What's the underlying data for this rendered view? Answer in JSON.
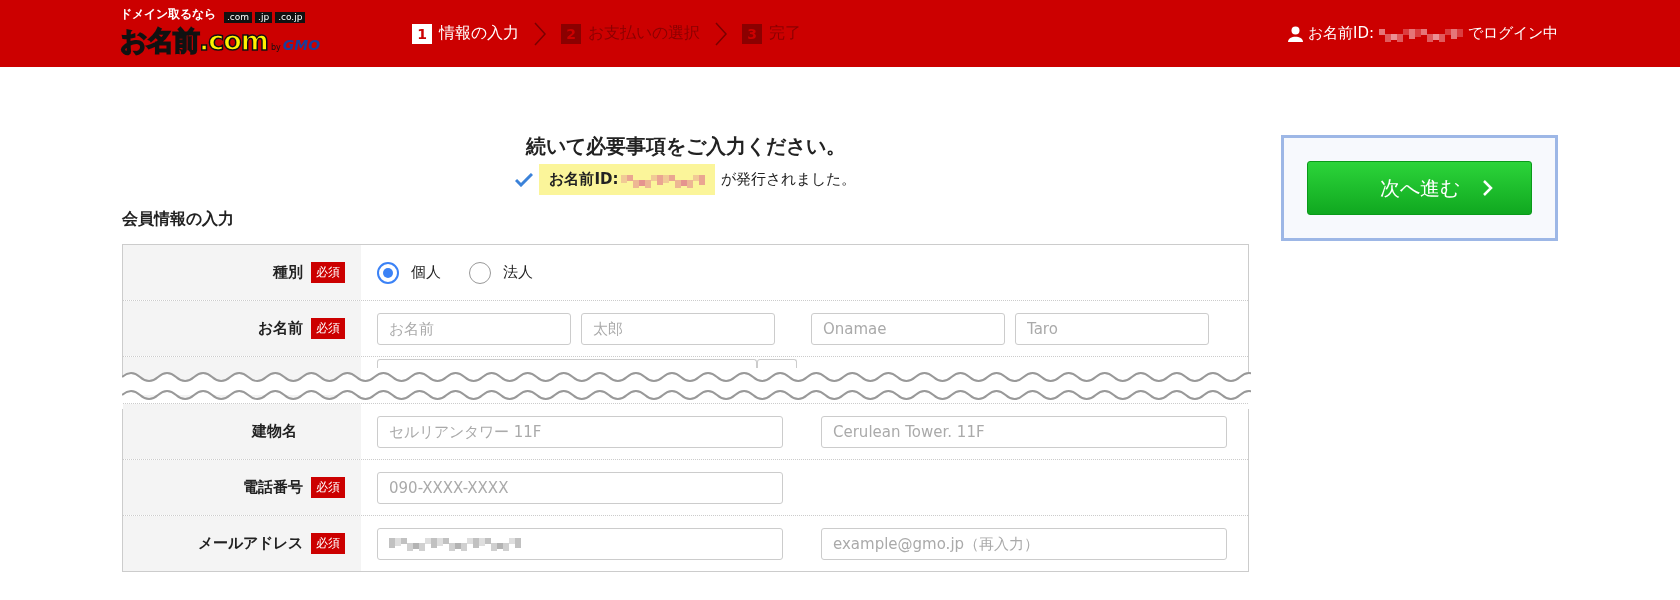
{
  "header": {
    "logo": {
      "tagline": "ドメイン取るなら",
      "domains": [
        ".com",
        ".jp",
        ".co.jp"
      ],
      "name": "お名前.com",
      "by": "by",
      "brand": "GMO"
    },
    "steps": [
      {
        "number": "1",
        "label": "情報の入力",
        "selected": true
      },
      {
        "number": "2",
        "label": "お支払いの選択",
        "selected": false
      },
      {
        "number": "3",
        "label": "完了",
        "selected": false
      }
    ],
    "login": {
      "prefix": "お名前ID:",
      "suffix": "でログイン中"
    }
  },
  "intro": {
    "heading": "続いて必要事項をご入力ください。",
    "notice_label": "お名前ID:",
    "notice_suffix": "が発行されました。"
  },
  "section_title": "会員情報の入力",
  "rows": [
    {
      "kind": "radio",
      "label": "種別",
      "badge": "必須",
      "options": [
        {
          "label": "個人",
          "selected": true
        },
        {
          "label": "法人",
          "selected": false
        }
      ]
    },
    {
      "kind": "fields",
      "label": "お名前",
      "badge": "必須",
      "fields": [
        {
          "kind": "short",
          "placeholder": "お名前"
        },
        {
          "kind": "short",
          "placeholder": "太郎"
        },
        {
          "kind": "short",
          "placeholder": "Onamae"
        },
        {
          "kind": "short",
          "placeholder": "Taro"
        }
      ]
    },
    {
      "kind": "cut"
    },
    {
      "kind": "fields",
      "label": "建物名",
      "fields": [
        {
          "kind": "long",
          "placeholder": "セルリアンタワー 11F"
        },
        {
          "kind": "long",
          "placeholder": "Cerulean Tower. 11F"
        }
      ]
    },
    {
      "kind": "fields",
      "label": "電話番号",
      "badge": "必須",
      "fields": [
        {
          "kind": "long",
          "placeholder": "090-XXXX-XXXX"
        }
      ]
    },
    {
      "kind": "fields",
      "label": "メールアドレス",
      "badge": "必須",
      "fields": [
        {
          "kind": "long",
          "masked": true
        },
        {
          "kind": "long",
          "masked": false,
          "placeholder": "example@gmo.jp（再入力）"
        }
      ]
    }
  ],
  "next_button": "次へ進む"
}
